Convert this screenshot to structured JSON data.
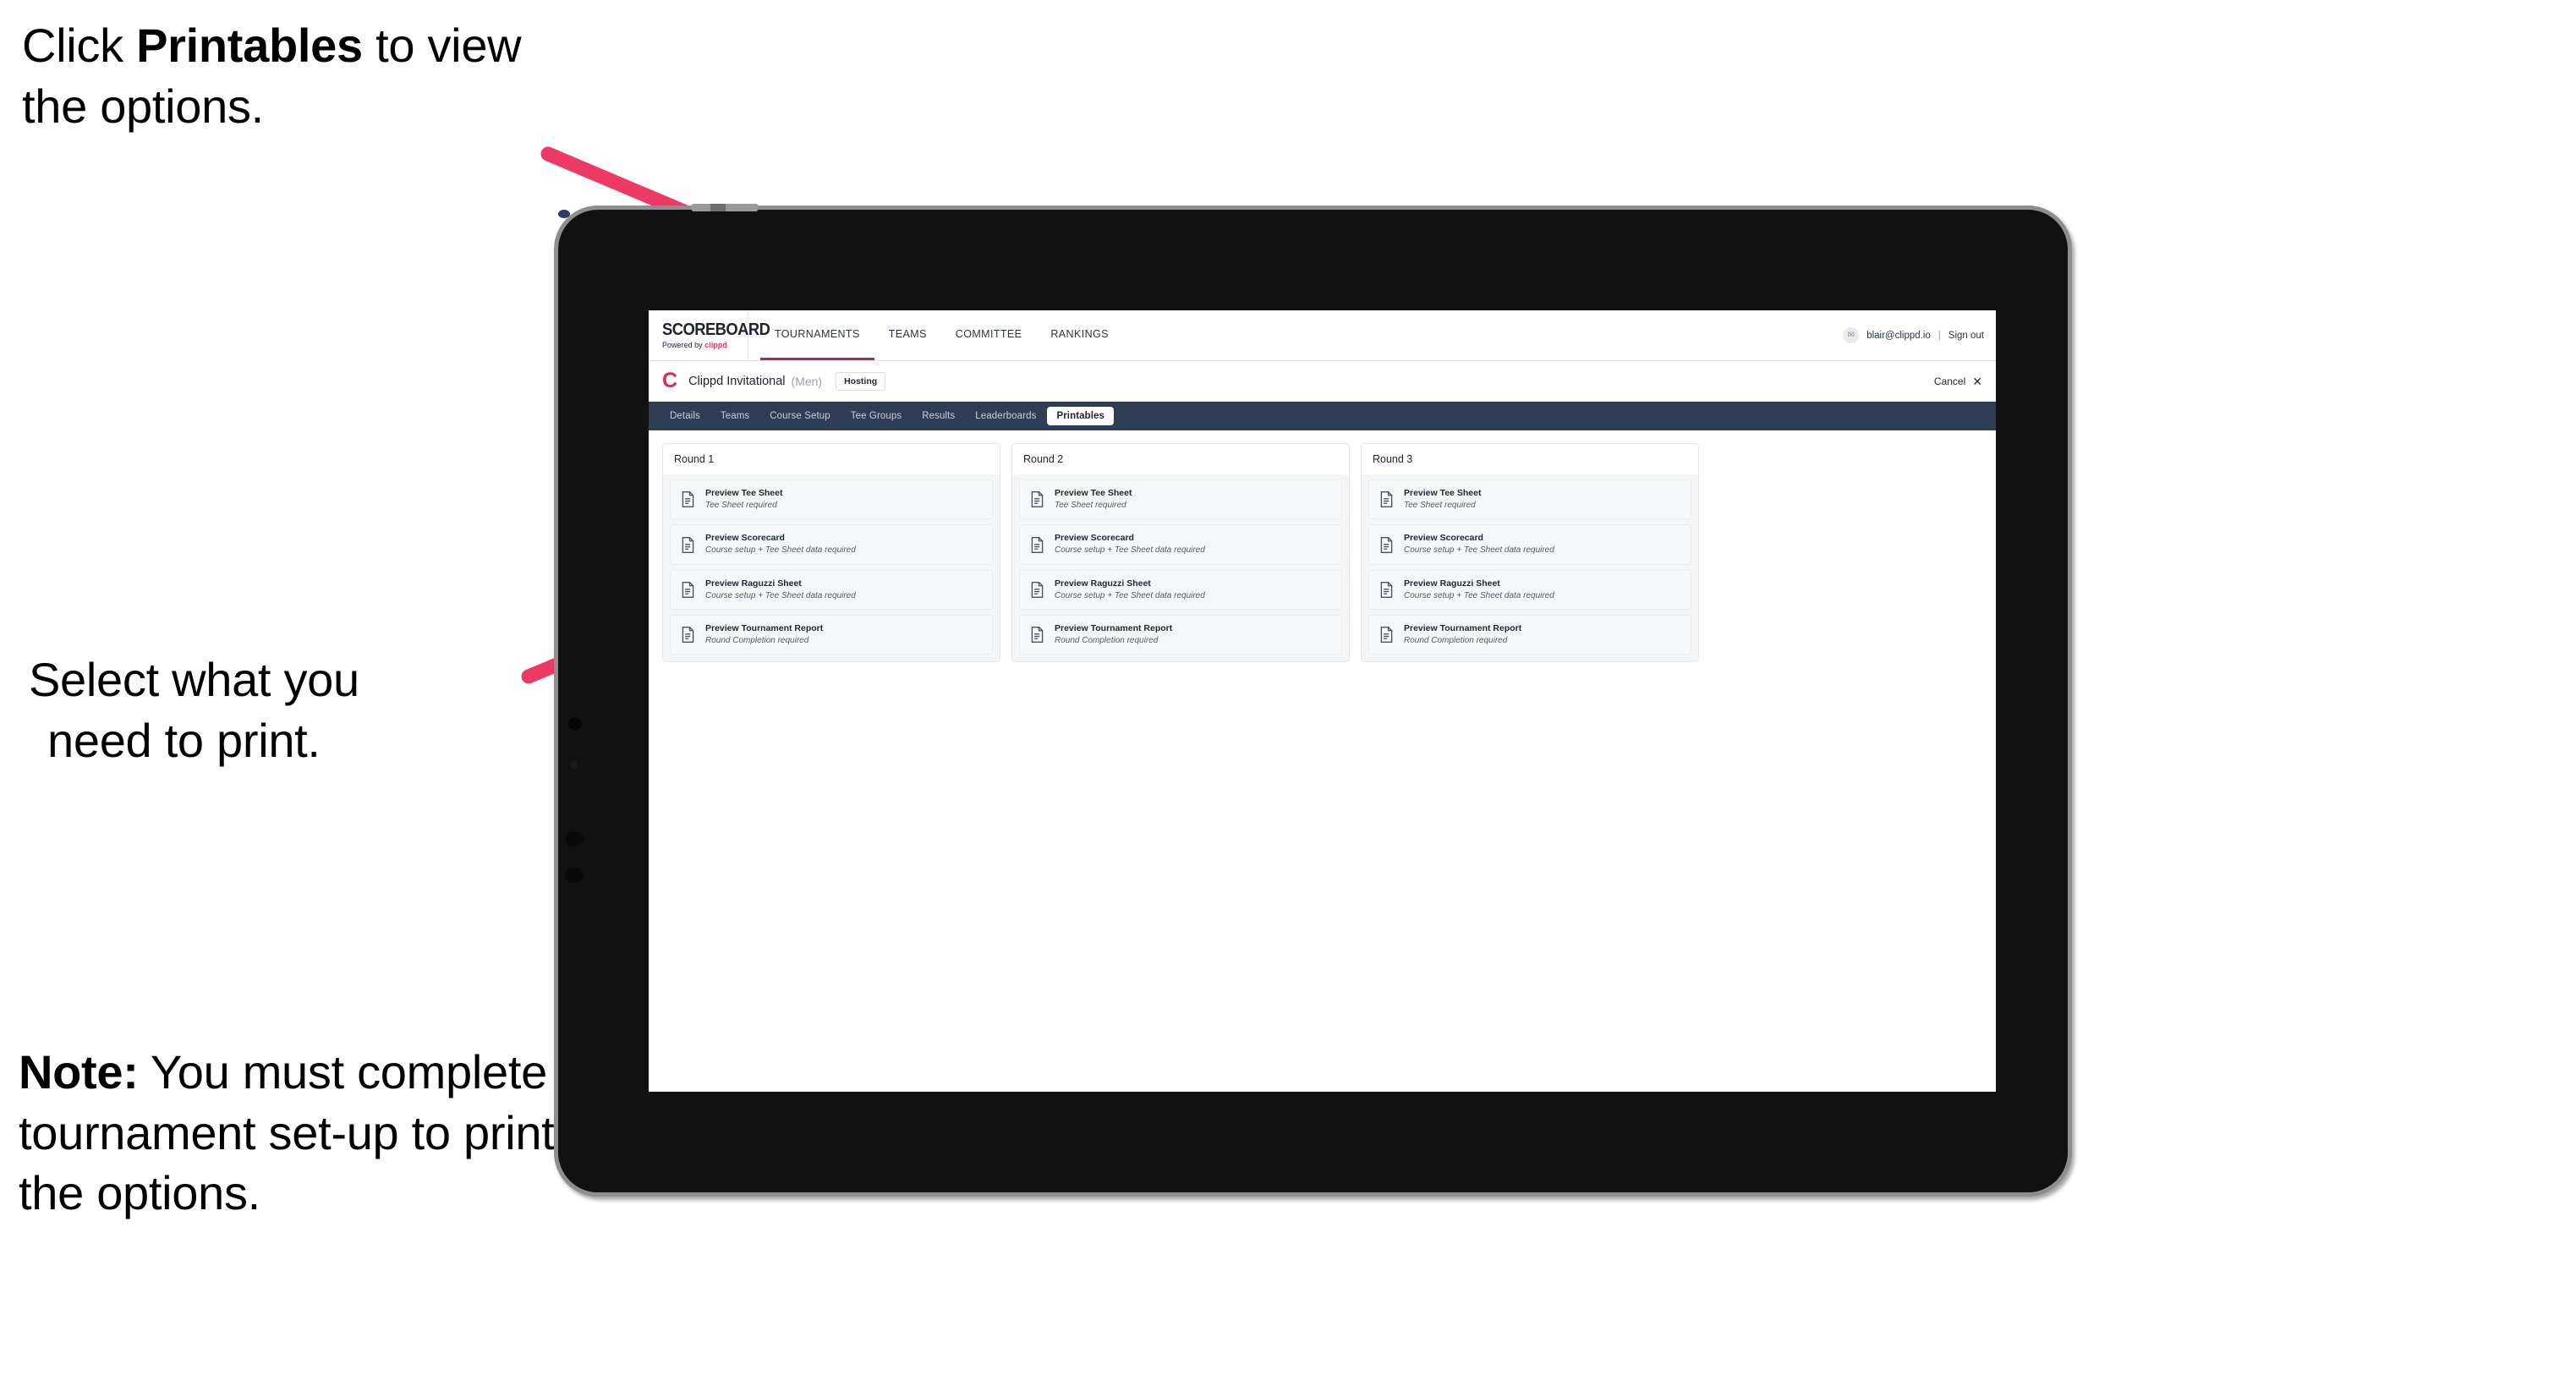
{
  "annotations": {
    "top": {
      "prefix": "Click ",
      "bold": "Printables",
      "suffix": " to view the options."
    },
    "middle": {
      "line1": "Select what you",
      "line2": "need to print."
    },
    "bottom": {
      "bold": "Note:",
      "text": " You must complete the tournament set-up to print all the options."
    }
  },
  "colors": {
    "arrow": "#ec3a64",
    "navbar": "#2e3d54",
    "brand_pink": "#e02a54",
    "tab_active_underline": "#9c2f4a"
  },
  "app": {
    "logo": {
      "main": "SCOREBOARD",
      "sub_prefix": "Powered by ",
      "sub_brand": "clippd"
    },
    "nav": [
      {
        "label": "TOURNAMENTS",
        "active": true
      },
      {
        "label": "TEAMS",
        "active": false
      },
      {
        "label": "COMMITTEE",
        "active": false
      },
      {
        "label": "RANKINGS",
        "active": false
      }
    ],
    "account": {
      "avatar_glyph": "✉",
      "email": "blair@clippd.io",
      "separator": "|",
      "sign_out": "Sign out"
    },
    "tournament": {
      "logo_letter": "C",
      "name": "Clippd Invitational",
      "gender": "(Men)",
      "badge": "Hosting",
      "cancel_label": "Cancel",
      "cancel_icon": "✕"
    },
    "tabs": [
      {
        "label": "Details",
        "active": false
      },
      {
        "label": "Teams",
        "active": false
      },
      {
        "label": "Course Setup",
        "active": false
      },
      {
        "label": "Tee Groups",
        "active": false
      },
      {
        "label": "Results",
        "active": false
      },
      {
        "label": "Leaderboards",
        "active": false
      },
      {
        "label": "Printables",
        "active": true
      }
    ],
    "rounds": [
      {
        "title": "Round 1",
        "items": [
          {
            "title": "Preview Tee Sheet",
            "sub": "Tee Sheet required"
          },
          {
            "title": "Preview Scorecard",
            "sub": "Course setup + Tee Sheet data required"
          },
          {
            "title": "Preview Raguzzi Sheet",
            "sub": "Course setup + Tee Sheet data required"
          },
          {
            "title": "Preview Tournament Report",
            "sub": "Round Completion required"
          }
        ]
      },
      {
        "title": "Round 2",
        "items": [
          {
            "title": "Preview Tee Sheet",
            "sub": "Tee Sheet required"
          },
          {
            "title": "Preview Scorecard",
            "sub": "Course setup + Tee Sheet data required"
          },
          {
            "title": "Preview Raguzzi Sheet",
            "sub": "Course setup + Tee Sheet data required"
          },
          {
            "title": "Preview Tournament Report",
            "sub": "Round Completion required"
          }
        ]
      },
      {
        "title": "Round 3",
        "items": [
          {
            "title": "Preview Tee Sheet",
            "sub": "Tee Sheet required"
          },
          {
            "title": "Preview Scorecard",
            "sub": "Course setup + Tee Sheet data required"
          },
          {
            "title": "Preview Raguzzi Sheet",
            "sub": "Course setup + Tee Sheet data required"
          },
          {
            "title": "Preview Tournament Report",
            "sub": "Round Completion required"
          }
        ]
      }
    ]
  }
}
